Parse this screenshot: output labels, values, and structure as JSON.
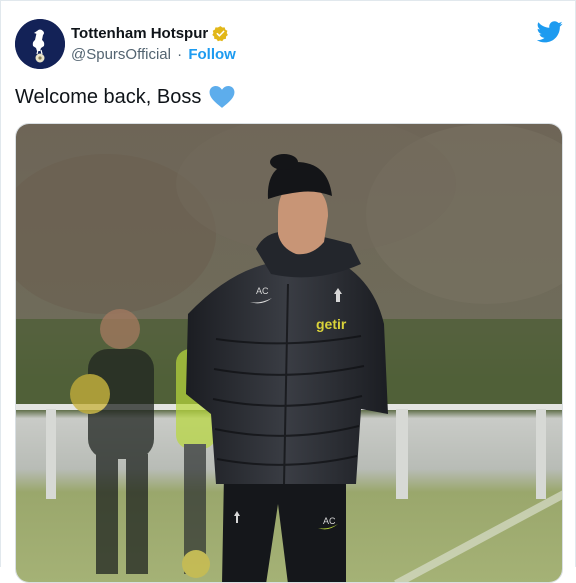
{
  "account": {
    "display_name": "Tottenham Hotspur",
    "handle": "@SpursOfficial",
    "separator": "·",
    "follow_label": "Follow"
  },
  "tweet": {
    "text": "Welcome back, Boss"
  },
  "photo": {
    "jacket_brand": "getir",
    "jacket_initials": "AC",
    "trousers_initials": "AC"
  },
  "icons": {
    "verified": "verified-badge-icon",
    "bird": "twitter-bird-icon",
    "heart": "blue-heart-emoji"
  },
  "colors": {
    "link_blue": "#1d9bf0",
    "verified_gold": "#e2b719",
    "heart_blue": "#5dadec",
    "spurs_navy": "#132257"
  }
}
